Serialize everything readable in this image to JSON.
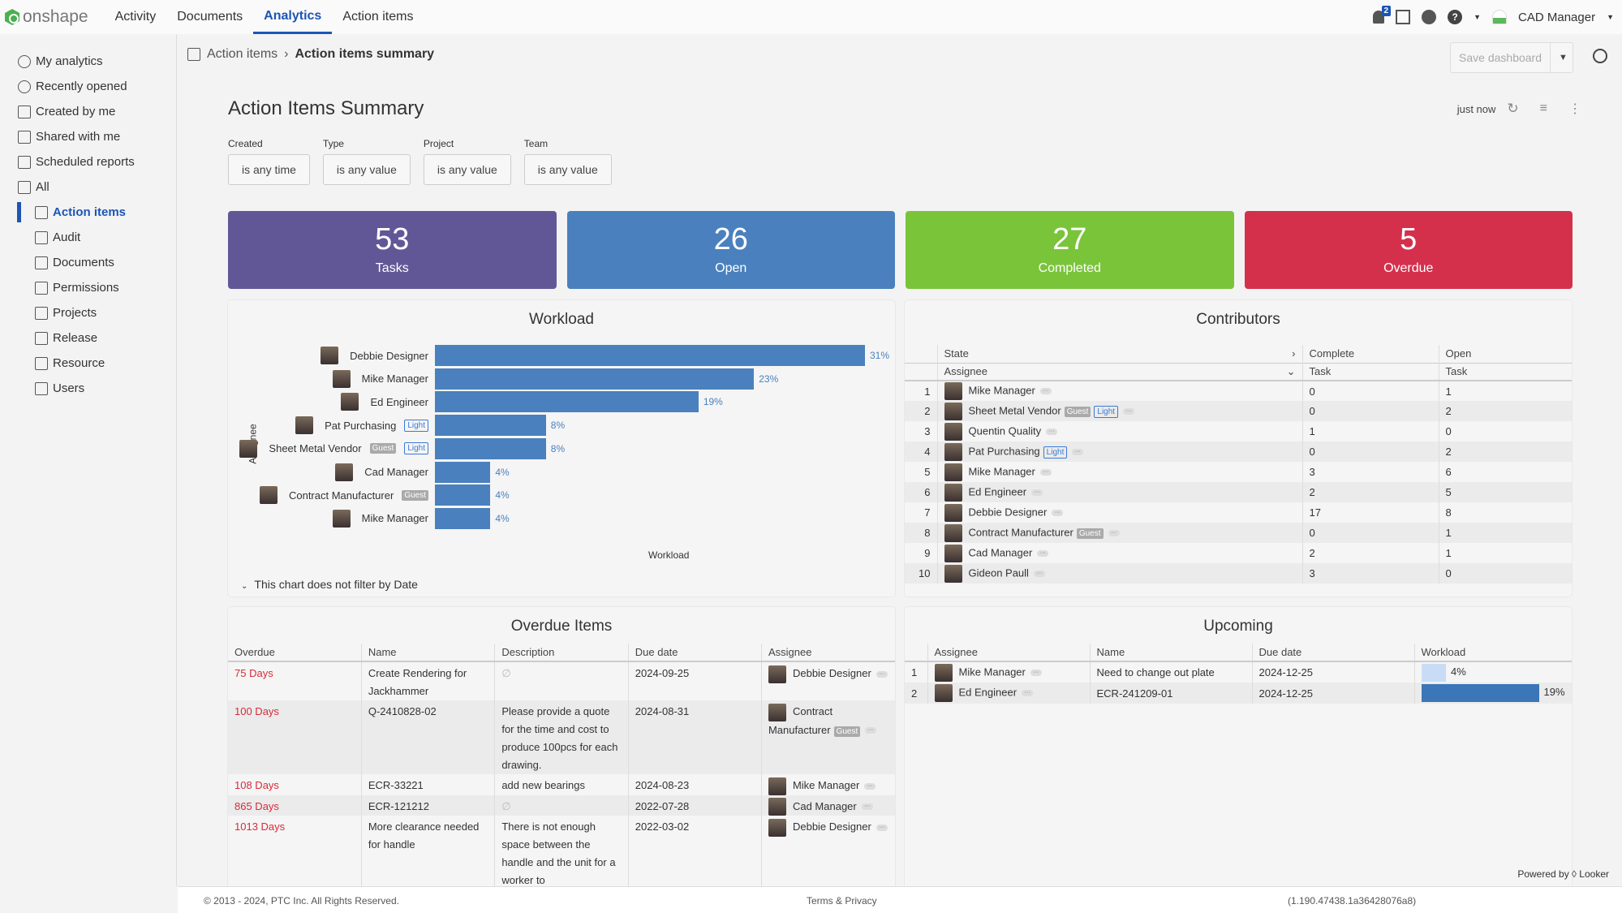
{
  "topbar": {
    "brand": "onshape",
    "nav": [
      "Activity",
      "Documents",
      "Analytics",
      "Action items"
    ],
    "active_nav": "Analytics",
    "notifications": "2",
    "user": "CAD Manager"
  },
  "sidebar": {
    "items": [
      {
        "label": "My analytics",
        "icon": "user-circle-icon",
        "sub": false
      },
      {
        "label": "Recently opened",
        "icon": "clock-icon",
        "sub": false
      },
      {
        "label": "Created by me",
        "icon": "document-icon",
        "sub": false
      },
      {
        "label": "Shared with me",
        "icon": "shared-icon",
        "sub": false
      },
      {
        "label": "Scheduled reports",
        "icon": "calendar-clock-icon",
        "sub": false
      },
      {
        "label": "All",
        "icon": "analytics-icon",
        "sub": false
      },
      {
        "label": "Action items",
        "icon": "analytics-icon",
        "sub": true,
        "active": true
      },
      {
        "label": "Audit",
        "icon": "analytics-icon",
        "sub": true
      },
      {
        "label": "Documents",
        "icon": "analytics-icon",
        "sub": true
      },
      {
        "label": "Permissions",
        "icon": "analytics-icon",
        "sub": true
      },
      {
        "label": "Projects",
        "icon": "analytics-icon",
        "sub": true
      },
      {
        "label": "Release",
        "icon": "analytics-icon",
        "sub": true
      },
      {
        "label": "Resource",
        "icon": "analytics-icon",
        "sub": true
      },
      {
        "label": "Users",
        "icon": "analytics-icon",
        "sub": true
      }
    ]
  },
  "breadcrumb": {
    "parent": "Action items",
    "current": "Action items summary"
  },
  "toolbar": {
    "save_label": "Save dashboard",
    "refreshed": "just now"
  },
  "dashboard": {
    "title": "Action Items Summary",
    "filters": [
      {
        "label": "Created",
        "value": "is any time"
      },
      {
        "label": "Type",
        "value": "is any value"
      },
      {
        "label": "Project",
        "value": "is any value"
      },
      {
        "label": "Team",
        "value": "is any value"
      }
    ],
    "kpis": [
      {
        "value": "53",
        "label": "Tasks",
        "color": "#625796"
      },
      {
        "value": "26",
        "label": "Open",
        "color": "#4a80be"
      },
      {
        "value": "27",
        "label": "Completed",
        "color": "#7ac43a"
      },
      {
        "value": "5",
        "label": "Overdue",
        "color": "#d4304c"
      }
    ]
  },
  "chart_data": {
    "type": "bar",
    "title": "Workload",
    "xlabel": "Workload",
    "ylabel": "Assignee",
    "orientation": "horizontal",
    "categories": [
      "Debbie Designer",
      "Mike Manager",
      "Ed Engineer",
      "Pat Purchasing",
      "Sheet Metal Vendor",
      "Cad Manager",
      "Contract Manufacturer",
      "Mike Manager"
    ],
    "tags": [
      [],
      [],
      [],
      [
        "Light"
      ],
      [
        "Guest",
        "Light"
      ],
      [],
      [
        "Guest"
      ],
      []
    ],
    "values": [
      31,
      23,
      19,
      8,
      8,
      4,
      4,
      4
    ],
    "unit": "%",
    "color": "#4a80be",
    "note": "This chart does not filter by Date"
  },
  "contributors": {
    "title": "Contributors",
    "pivot_header": "State",
    "row_header": "Assignee",
    "columns": [
      {
        "state": "Complete",
        "measure": "Task"
      },
      {
        "state": "Open",
        "measure": "Task"
      }
    ],
    "rows": [
      {
        "n": "1",
        "name": "Mike Manager",
        "tags": [],
        "complete": "0",
        "open": "1"
      },
      {
        "n": "2",
        "name": "Sheet Metal Vendor",
        "tags": [
          "Guest",
          "Light"
        ],
        "complete": "0",
        "open": "2"
      },
      {
        "n": "3",
        "name": "Quentin Quality",
        "tags": [],
        "complete": "1",
        "open": "0"
      },
      {
        "n": "4",
        "name": "Pat Purchasing",
        "tags": [
          "Light"
        ],
        "complete": "0",
        "open": "2"
      },
      {
        "n": "5",
        "name": "Mike Manager",
        "tags": [],
        "complete": "3",
        "open": "6"
      },
      {
        "n": "6",
        "name": "Ed Engineer",
        "tags": [],
        "complete": "2",
        "open": "5"
      },
      {
        "n": "7",
        "name": "Debbie Designer",
        "tags": [],
        "complete": "17",
        "open": "8"
      },
      {
        "n": "8",
        "name": "Contract Manufacturer",
        "tags": [
          "Guest"
        ],
        "complete": "0",
        "open": "1"
      },
      {
        "n": "9",
        "name": "Cad Manager",
        "tags": [],
        "complete": "2",
        "open": "1"
      },
      {
        "n": "10",
        "name": "Gideon Paull",
        "tags": [],
        "complete": "3",
        "open": "0"
      }
    ]
  },
  "overdue": {
    "title": "Overdue Items",
    "columns": [
      "Overdue",
      "Name",
      "Description",
      "Due date",
      "Assignee"
    ],
    "rows": [
      {
        "overdue": "75 Days",
        "name": "Create Rendering for Jackhammer",
        "desc": "∅",
        "due": "2024-09-25",
        "assignee": "Debbie Designer",
        "tags": []
      },
      {
        "overdue": "100 Days",
        "name": "Q-2410828-02",
        "desc": "Please provide a quote for the time and cost to produce 100pcs for each drawing.",
        "due": "2024-08-31",
        "assignee": "Contract Manufacturer",
        "tags": [
          "Guest"
        ]
      },
      {
        "overdue": "108 Days",
        "name": "ECR-33221",
        "desc": "add new bearings",
        "due": "2024-08-23",
        "assignee": "Mike Manager",
        "tags": []
      },
      {
        "overdue": "865 Days",
        "name": "ECR-121212",
        "desc": "∅",
        "due": "2022-07-28",
        "assignee": "Cad Manager",
        "tags": []
      },
      {
        "overdue": "1013 Days",
        "name": "More clearance needed for handle",
        "desc": "There is not enough space between the handle and the unit for a worker to",
        "due": "2022-03-02",
        "assignee": "Debbie Designer",
        "tags": []
      }
    ]
  },
  "upcoming": {
    "title": "Upcoming",
    "columns": [
      "Assignee",
      "Name",
      "Due date",
      "Workload"
    ],
    "rows": [
      {
        "n": "1",
        "assignee": "Mike Manager",
        "name": "Need to change out plate",
        "due": "2024-12-25",
        "workload": 4
      },
      {
        "n": "2",
        "assignee": "Ed Engineer",
        "name": "ECR-241209-01",
        "due": "2024-12-25",
        "workload": 19
      }
    ]
  },
  "footer": {
    "copyright": "© 2013 - 2024, PTC Inc. All Rights Reserved.",
    "terms": "Terms & Privacy",
    "version": "(1.190.47438.1a36428076a8)",
    "powered": "Powered by ◊ Looker"
  }
}
